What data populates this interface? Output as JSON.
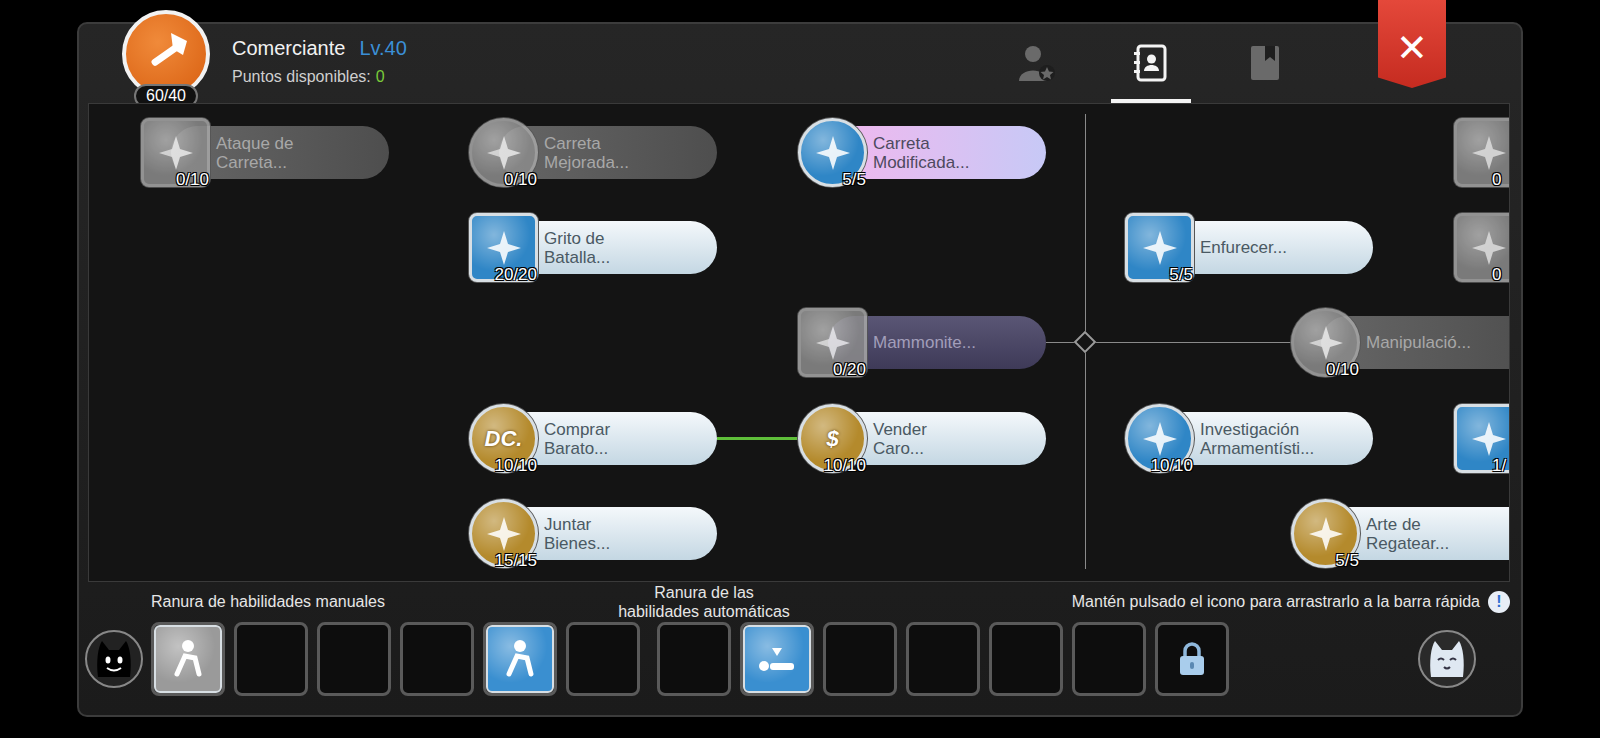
{
  "character": {
    "class": "Comerciante",
    "level": "Lv.40",
    "badge": "60/40"
  },
  "points": {
    "label": "Puntos disponibles:",
    "value": "0"
  },
  "tabs": [
    {
      "selected": false
    },
    {
      "selected": true
    },
    {
      "selected": false
    }
  ],
  "close": "✕",
  "skills": [
    {
      "label": "Ataque de\nCarreta...",
      "level": "0/10",
      "kind": "unlearned",
      "frame": "square",
      "color": "#8c8c8c",
      "glyph": ""
    },
    {
      "label": "Carreta\nMejorada...",
      "level": "0/10",
      "kind": "unlearned",
      "frame": "round",
      "color": "#8c8c8c",
      "glyph": ""
    },
    {
      "label": "Carreta\nModificada...",
      "level": "5/5",
      "kind": "rare",
      "frame": "round",
      "color": "#2f86c6",
      "glyph": ""
    },
    {
      "level": "0",
      "kind": "unlearned",
      "frame": "square",
      "color": "#8c8c8c",
      "glyph": ""
    },
    {
      "label": "Grito de\nBatalla...",
      "level": "20/20",
      "kind": "learned",
      "frame": "square",
      "color": "#2f86c6",
      "glyph": ""
    },
    {
      "label": "Enfurecer...",
      "level": "5/5",
      "kind": "learned",
      "frame": "square",
      "color": "#2f86c6",
      "glyph": ""
    },
    {
      "level": "0",
      "kind": "unlearned",
      "frame": "square",
      "color": "#8c8c8c",
      "glyph": ""
    },
    {
      "label": "Mammonite...",
      "level": "0/20",
      "kind": "shadow",
      "frame": "square",
      "color": "#8c8c8c",
      "glyph": ""
    },
    {
      "label": "Manipulació...",
      "level": "0/10",
      "kind": "unlearned",
      "frame": "round",
      "color": "#8c8c8c",
      "glyph": ""
    },
    {
      "label": "Comprar\nBarato...",
      "level": "10/10",
      "kind": "learned",
      "frame": "round",
      "color": "#b48a2c",
      "glyph": "DC."
    },
    {
      "label": "Vender\nCaro...",
      "level": "10/10",
      "kind": "learned",
      "frame": "round",
      "color": "#b48a2c",
      "glyph": "$"
    },
    {
      "label": "Investigación\nArmamentísti...",
      "level": "10/10",
      "kind": "learned",
      "frame": "round",
      "color": "#2f86c6",
      "glyph": ""
    },
    {
      "level": "1/",
      "kind": "learned",
      "frame": "square",
      "color": "#2f86c6",
      "glyph": ""
    },
    {
      "label": "Juntar\nBienes...",
      "level": "15/15",
      "kind": "learned",
      "frame": "round",
      "color": "#b48a2c",
      "glyph": ""
    },
    {
      "label": "Arte de\nRegatear...",
      "level": "5/5",
      "kind": "learned",
      "frame": "round",
      "color": "#b48a2c",
      "glyph": ""
    }
  ],
  "links": [
    {
      "from": 9,
      "to": 10,
      "active": true
    }
  ],
  "slot_labels": {
    "manual": "Ranura de habilidades manuales",
    "auto": "Ranura de las\nhabilidades automáticas",
    "hint": "Mantén pulsado el icono para arrastrarlo a la barra rápida",
    "hint_icon": "!"
  },
  "manual_slots": [
    {
      "kind": "skill",
      "color": "#9a9a9a"
    },
    {
      "kind": "empty"
    },
    {
      "kind": "empty"
    },
    {
      "kind": "empty"
    },
    {
      "kind": "skill",
      "color": "#3a8fd0"
    },
    {
      "kind": "empty"
    }
  ],
  "auto_slots": [
    {
      "kind": "empty"
    },
    {
      "kind": "skill",
      "color": "#3a8fd0"
    },
    {
      "kind": "empty"
    },
    {
      "kind": "empty"
    },
    {
      "kind": "empty"
    },
    {
      "kind": "empty"
    },
    {
      "kind": "locked"
    }
  ]
}
